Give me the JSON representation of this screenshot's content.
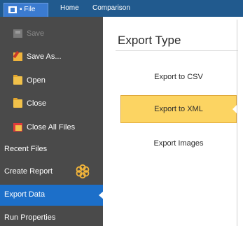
{
  "ribbon": {
    "file_tab": "File",
    "file_prefix": "▪",
    "tabs": [
      "Home",
      "Comparison"
    ]
  },
  "sidebar": {
    "items": [
      {
        "label": "Save",
        "icon": "save-icon",
        "enabled": false
      },
      {
        "label": "Save As...",
        "icon": "save-as-icon",
        "enabled": true
      },
      {
        "label": "Open",
        "icon": "folder-icon",
        "enabled": true
      },
      {
        "label": "Close",
        "icon": "folder-icon",
        "enabled": true
      },
      {
        "label": "Close All Files",
        "icon": "close-all-icon",
        "enabled": true
      },
      {
        "label": "Recent Files",
        "enabled": true
      },
      {
        "label": "Create Report",
        "icon": "gear-icon",
        "enabled": true
      },
      {
        "label": "Export Data",
        "active": true
      },
      {
        "label": "Run Properties"
      }
    ]
  },
  "content": {
    "title": "Export Type",
    "options": [
      {
        "label": "Export to CSV",
        "selected": false
      },
      {
        "label": "Export to XML",
        "selected": true
      },
      {
        "label": "Export Images",
        "selected": false
      }
    ]
  },
  "colors": {
    "ribbon": "#215a8e",
    "sidebar": "#4a4a4a",
    "active_item": "#1c6fc9",
    "selected_option": "#fcd462",
    "gear": "#f3b53a"
  }
}
